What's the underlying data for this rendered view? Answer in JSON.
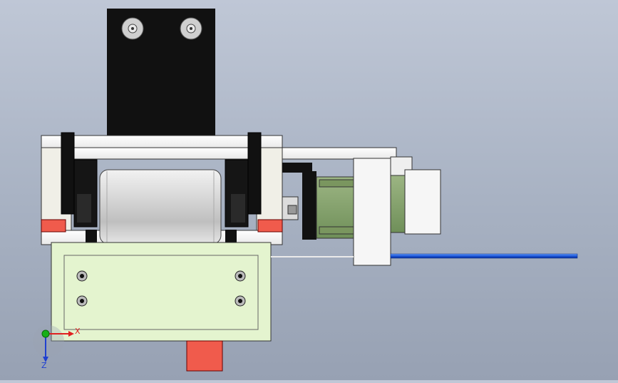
{
  "viewport": {
    "background_top": "#bfc7d6",
    "background_bottom": "#97a1b3"
  },
  "colors": {
    "black_part": "#111111",
    "white_part": "#f4f4f4",
    "green_base": "#e4f4cf",
    "green_motor": "#8da674",
    "red_part": "#f05b4c",
    "cylinder": "#d7d7d7",
    "blue_rod": "#2b63d9"
  },
  "triad": {
    "x_label": "X",
    "z_label": "Z",
    "x_color": "#e02020",
    "y_color": "#18b018",
    "z_color": "#2040d0"
  }
}
